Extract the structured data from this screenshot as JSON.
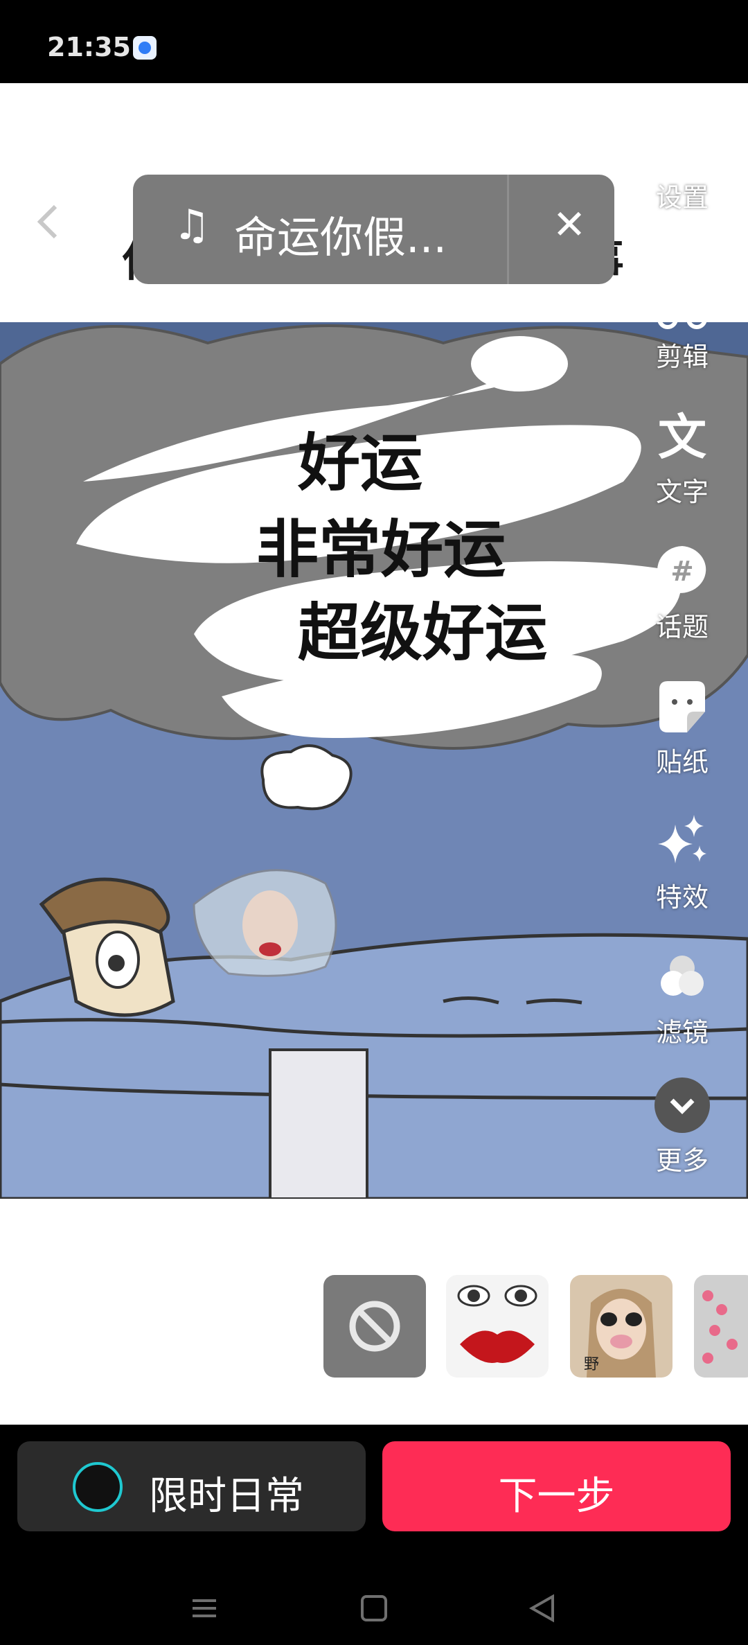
{
  "status_bar": {
    "time": "21:35"
  },
  "music": {
    "title": "命运你假...",
    "note_icon": "music-note-icon",
    "close_icon": "close-icon"
  },
  "meme": {
    "title": "你未来几天躲不开的大事",
    "lines": [
      "好运",
      "非常好运",
      "超级好运"
    ]
  },
  "toolbar": {
    "items": [
      {
        "label": "设置",
        "icon": "gear-icon"
      },
      {
        "label": "剪辑",
        "icon": "scissors-icon"
      },
      {
        "label": "文字",
        "icon": "text-icon"
      },
      {
        "label": "话题",
        "icon": "hashtag-icon"
      },
      {
        "label": "贴纸",
        "icon": "sticker-icon"
      },
      {
        "label": "特效",
        "icon": "sparkle-icon"
      },
      {
        "label": "滤镜",
        "icon": "filter-icon"
      },
      {
        "label": "更多",
        "icon": "chevron-down-icon"
      }
    ]
  },
  "effects": {
    "items": [
      {
        "name": "none-effect",
        "icon": "ban-icon"
      },
      {
        "name": "lips-eyes-effect"
      },
      {
        "name": "pig-nose-effect",
        "badge": "野"
      },
      {
        "name": "pink-hearts-effect"
      }
    ]
  },
  "bottom": {
    "daily_label": "限时日常",
    "next_label": "下一步"
  },
  "colors": {
    "primary": "#fe2c55",
    "accent_ring": "#1fc8d0"
  }
}
